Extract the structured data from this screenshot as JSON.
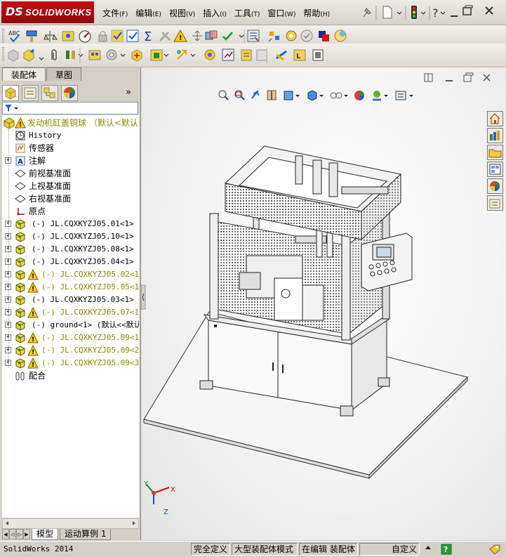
{
  "app": {
    "brand_ds": "DS",
    "brand_name": "SOLIDWORKS"
  },
  "menu": [
    {
      "label": "文件",
      "key": "(F)"
    },
    {
      "label": "编辑",
      "key": "(E)"
    },
    {
      "label": "视图",
      "key": "(V)"
    },
    {
      "label": "插入",
      "key": "(I)"
    },
    {
      "label": "工具",
      "key": "(T)"
    },
    {
      "label": "窗口",
      "key": "(W)"
    },
    {
      "label": "帮助",
      "key": "(H)"
    }
  ],
  "feature_tabs": [
    {
      "label": "装配体",
      "active": true
    },
    {
      "label": "草图",
      "active": false
    }
  ],
  "tree": {
    "root": "发动机缸盖铜球 （默认<默认",
    "items": [
      {
        "label": "History",
        "icon": "history-icon",
        "expander": false,
        "warn": false,
        "cjk": false
      },
      {
        "label": "传感器",
        "icon": "sensor-icon",
        "expander": false,
        "warn": false,
        "cjk": true
      },
      {
        "label": "注解",
        "icon": "annotation-icon",
        "expander": true,
        "warn": false,
        "cjk": true
      },
      {
        "label": "前视基准面",
        "icon": "plane-icon",
        "expander": false,
        "warn": false,
        "cjk": true
      },
      {
        "label": "上视基准面",
        "icon": "plane-icon",
        "expander": false,
        "warn": false,
        "cjk": true
      },
      {
        "label": "右视基准面",
        "icon": "plane-icon",
        "expander": false,
        "warn": false,
        "cjk": true
      },
      {
        "label": "原点",
        "icon": "origin-icon",
        "expander": false,
        "warn": false,
        "cjk": true
      },
      {
        "label": "(-) JL.CQXKYZJ05.01<1> (默",
        "icon": "part-icon",
        "expander": true,
        "warn": false,
        "cjk": false
      },
      {
        "label": "(-) JL.CQXKYZJ05.10<1> (默",
        "icon": "part-icon",
        "expander": true,
        "warn": false,
        "cjk": false
      },
      {
        "label": "(-) JL.CQXKYZJ05.08<1> (默",
        "icon": "part-icon",
        "expander": true,
        "warn": false,
        "cjk": false
      },
      {
        "label": "(-) JL.CQXKYZJ05.04<1> (默",
        "icon": "part-icon",
        "expander": true,
        "warn": false,
        "cjk": false
      },
      {
        "label": "(-) JL.CQXKYZJ05.02<1>",
        "icon": "part-warning-icon",
        "expander": true,
        "warn": true,
        "cjk": false
      },
      {
        "label": "(-) JL.CQXKYZJ05.05<1>",
        "icon": "part-warning-icon",
        "expander": true,
        "warn": true,
        "cjk": false
      },
      {
        "label": "(-) JL.CQXKYZJ05.03<1> (默",
        "icon": "part-icon",
        "expander": true,
        "warn": false,
        "cjk": false
      },
      {
        "label": "(-) JL.CQXKYZJ05.07<1>",
        "icon": "part-warning-icon",
        "expander": true,
        "warn": true,
        "cjk": false
      },
      {
        "label": "(-) ground<1> (默认<<默认>",
        "icon": "part-icon",
        "expander": true,
        "warn": false,
        "cjk": false
      },
      {
        "label": "(-) JL.CQXKYZJ05.09<1>",
        "icon": "part-warning-icon",
        "expander": true,
        "warn": true,
        "cjk": false
      },
      {
        "label": "(-) JL.CQXKYZJ05.09<2>",
        "icon": "part-warning-icon",
        "expander": true,
        "warn": true,
        "cjk": false
      },
      {
        "label": "(-) JL.CQXKYZJ05.09<3>",
        "icon": "part-warning-icon",
        "expander": true,
        "warn": true,
        "cjk": false
      },
      {
        "label": "配合",
        "icon": "mates-icon",
        "expander": false,
        "warn": false,
        "cjk": true
      }
    ]
  },
  "bottom_tabs": [
    {
      "label": "模型",
      "active": true
    },
    {
      "label": "运动算例 1",
      "active": false
    }
  ],
  "triad": {
    "x": "X",
    "y": "Y",
    "z": "Z"
  },
  "status": {
    "app_version": "SolidWorks 2014",
    "constraint": "完全定义",
    "mode": "大型装配体模式",
    "editing": "在编辑 装配体",
    "custom": "自定义"
  },
  "colors": {
    "brand_red": "#c81014",
    "warning_yellow": "#f4d000",
    "part_yellow": "#e8d840",
    "viewport_bg": "#f3f3f3"
  }
}
